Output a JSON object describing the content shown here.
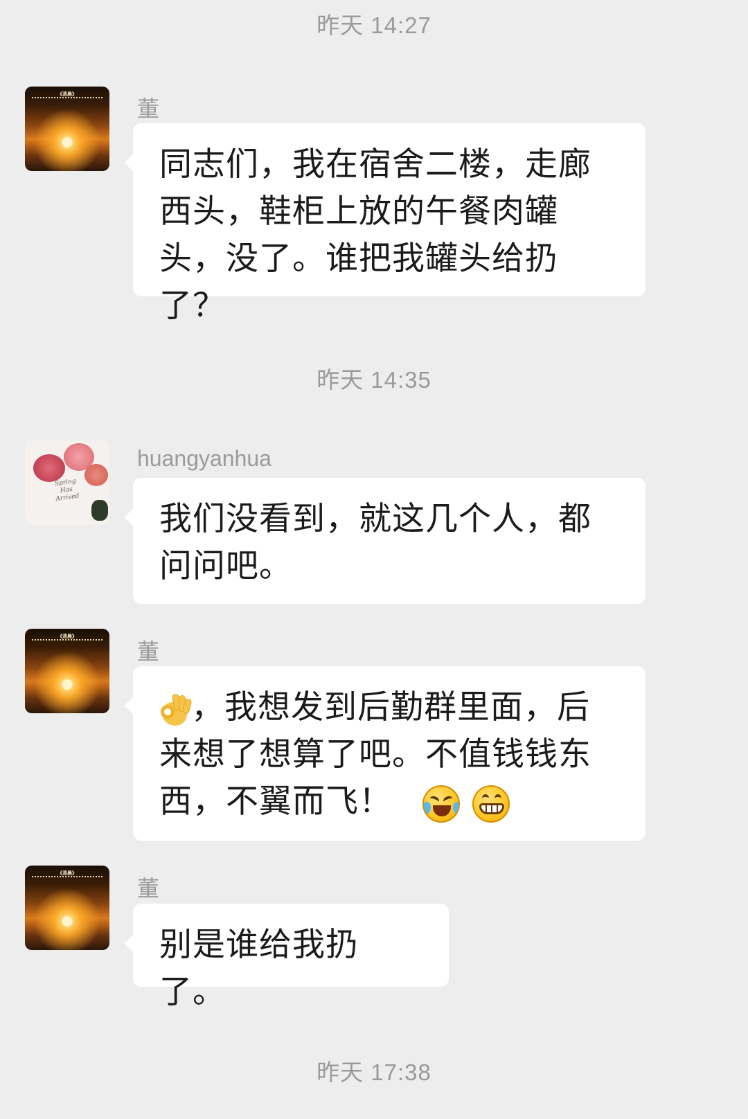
{
  "timestamps": [
    "昨天 14:27",
    "昨天 14:35",
    "昨天 17:38"
  ],
  "messages": [
    {
      "sender": "董",
      "text": "同志们，我在宿舍二楼，走廊西头，鞋柜上放的午餐肉罐头，没了。谁把我罐头给扔了？"
    },
    {
      "sender": "huangyanhua",
      "text": "我们没看到，就这几个人，都问问吧。"
    },
    {
      "sender": "董",
      "text": "，我想发到后勤群里面，后来想了想算了吧。不值钱钱东西，不翼而飞！",
      "emojis": [
        "ok-hand-icon",
        "laughing-tears-face-icon",
        "grinning-face-icon"
      ]
    },
    {
      "sender": "董",
      "text": "别是谁给我扔了。"
    }
  ],
  "avatars": {
    "dong": {
      "image": "sunset over sea",
      "caption": "《清晨》"
    },
    "huangyanhua": {
      "image": "roses with card",
      "caption": "Spring Has Arrived"
    }
  },
  "colors": {
    "background": "#ededed",
    "bubble": "#ffffff",
    "timestamp": "#9a9a9a",
    "name": "#9b9b9b"
  }
}
